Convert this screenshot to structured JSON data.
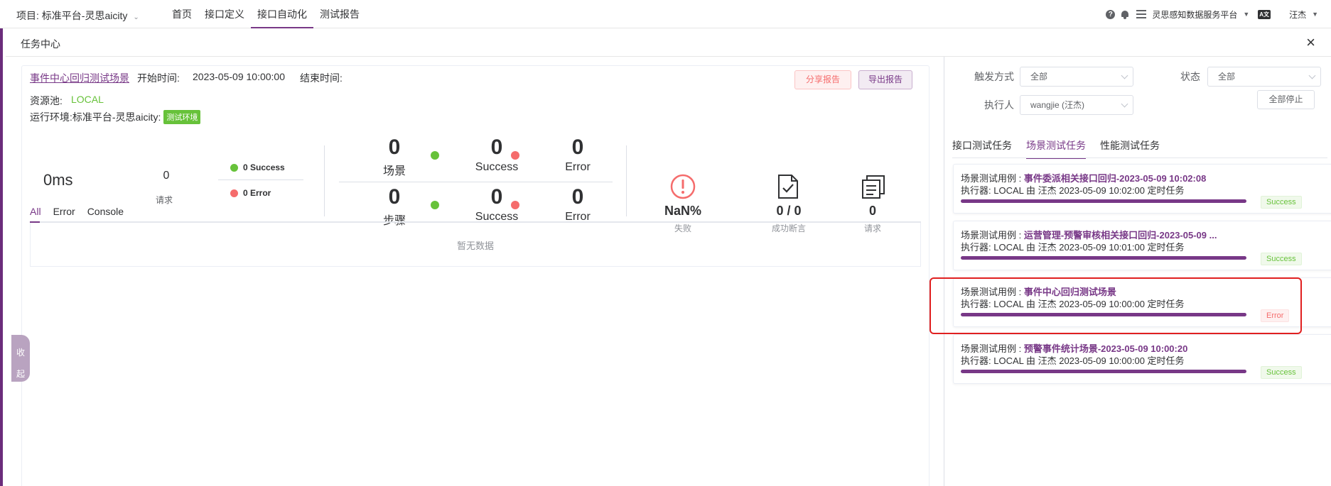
{
  "topbar": {
    "project": "项目: 标准平台-灵思aicity",
    "nav": [
      "首页",
      "接口定义",
      "接口自动化",
      "测试报告"
    ],
    "active_nav": 2,
    "org": "灵思感知数据服务平台",
    "lang_badge": "A文",
    "user": "汪杰"
  },
  "drawer": {
    "title": "任务中心",
    "close": "×"
  },
  "report": {
    "scenario_name": "事件中心回归测试场景",
    "start_label": "开始时间:",
    "start_value": "2023-05-09 10:00:00",
    "end_label": "结束时间:",
    "share_btn": "分享报告",
    "export_btn": "导出报告",
    "pool_label": "资源池:",
    "pool_value": "LOCAL",
    "env_label": "运行环境:标准平台-灵思aicity:",
    "env_tag": "测试环境",
    "duration": "0ms",
    "request_count": "0",
    "request_label": "请求",
    "success_summary": "0 Success",
    "error_summary": "0 Error",
    "scene_count": "0",
    "scene_label": "场景",
    "scene_success": "0",
    "scene_error": "0",
    "step_count": "0",
    "step_label": "步骤",
    "step_success": "0",
    "step_error": "0",
    "success_word": "Success",
    "error_word": "Error",
    "fail_rate": "NaN%",
    "fail_label": "失败",
    "assert_value": "0 / 0",
    "assert_label": "成功断言",
    "req_total": "0",
    "req_total_label": "请求",
    "tabs": [
      "All",
      "Error",
      "Console"
    ],
    "empty_text": "暂无数据",
    "collapse_text": "收起"
  },
  "filters": {
    "trigger_label": "触发方式",
    "trigger_value": "全部",
    "status_label": "状态",
    "status_value": "全部",
    "executor_label": "执行人",
    "executor_value": "wangjie (汪杰)",
    "stop_all": "全部停止"
  },
  "task_tabs": [
    "接口测试任务",
    "场景测试任务",
    "性能测试任务"
  ],
  "tasks": [
    {
      "prefix": "场景测试用例 : ",
      "name": "事件委派相关接口回归-2023-05-09 10:02:08",
      "meta": "执行器:   LOCAL 由 汪杰 2023-05-09 10:02:00 定时任务",
      "status": "Success",
      "progress": 1.0
    },
    {
      "prefix": "场景测试用例 : ",
      "name": "运营管理-预警审核相关接口回归-2023-05-09 ...",
      "meta": "执行器:   LOCAL 由 汪杰 2023-05-09 10:01:00 定时任务",
      "status": "Success",
      "progress": 1.0
    },
    {
      "prefix": "场景测试用例 : ",
      "name": "事件中心回归测试场景",
      "meta": "执行器:   LOCAL 由 汪杰 2023-05-09 10:00:00 定时任务",
      "status": "Error",
      "progress": 1.0
    },
    {
      "prefix": "场景测试用例 : ",
      "name": "预警事件统计场景-2023-05-09 10:00:20",
      "meta": "执行器:   LOCAL 由 汪杰 2023-05-09 10:00:00 定时任务",
      "status": "Success",
      "progress": 1.0
    }
  ],
  "colors": {
    "accent": "#783887",
    "success": "#67c23a",
    "error": "#f56c6c",
    "highlight": "#e02020"
  }
}
